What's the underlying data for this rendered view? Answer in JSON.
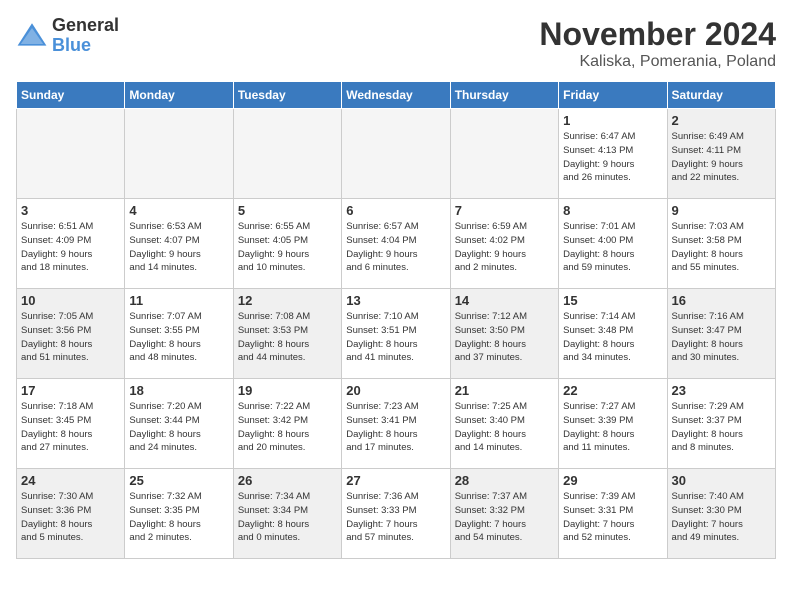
{
  "header": {
    "logo_line1": "General",
    "logo_line2": "Blue",
    "month": "November 2024",
    "location": "Kaliska, Pomerania, Poland"
  },
  "weekdays": [
    "Sunday",
    "Monday",
    "Tuesday",
    "Wednesday",
    "Thursday",
    "Friday",
    "Saturday"
  ],
  "weeks": [
    [
      {
        "day": "",
        "info": "",
        "empty": true
      },
      {
        "day": "",
        "info": "",
        "empty": true
      },
      {
        "day": "",
        "info": "",
        "empty": true
      },
      {
        "day": "",
        "info": "",
        "empty": true
      },
      {
        "day": "",
        "info": "",
        "empty": true
      },
      {
        "day": "1",
        "info": "Sunrise: 6:47 AM\nSunset: 4:13 PM\nDaylight: 9 hours\nand 26 minutes.",
        "empty": false
      },
      {
        "day": "2",
        "info": "Sunrise: 6:49 AM\nSunset: 4:11 PM\nDaylight: 9 hours\nand 22 minutes.",
        "empty": false
      }
    ],
    [
      {
        "day": "3",
        "info": "Sunrise: 6:51 AM\nSunset: 4:09 PM\nDaylight: 9 hours\nand 18 minutes.",
        "empty": false
      },
      {
        "day": "4",
        "info": "Sunrise: 6:53 AM\nSunset: 4:07 PM\nDaylight: 9 hours\nand 14 minutes.",
        "empty": false
      },
      {
        "day": "5",
        "info": "Sunrise: 6:55 AM\nSunset: 4:05 PM\nDaylight: 9 hours\nand 10 minutes.",
        "empty": false
      },
      {
        "day": "6",
        "info": "Sunrise: 6:57 AM\nSunset: 4:04 PM\nDaylight: 9 hours\nand 6 minutes.",
        "empty": false
      },
      {
        "day": "7",
        "info": "Sunrise: 6:59 AM\nSunset: 4:02 PM\nDaylight: 9 hours\nand 2 minutes.",
        "empty": false
      },
      {
        "day": "8",
        "info": "Sunrise: 7:01 AM\nSunset: 4:00 PM\nDaylight: 8 hours\nand 59 minutes.",
        "empty": false
      },
      {
        "day": "9",
        "info": "Sunrise: 7:03 AM\nSunset: 3:58 PM\nDaylight: 8 hours\nand 55 minutes.",
        "empty": false
      }
    ],
    [
      {
        "day": "10",
        "info": "Sunrise: 7:05 AM\nSunset: 3:56 PM\nDaylight: 8 hours\nand 51 minutes.",
        "empty": false
      },
      {
        "day": "11",
        "info": "Sunrise: 7:07 AM\nSunset: 3:55 PM\nDaylight: 8 hours\nand 48 minutes.",
        "empty": false
      },
      {
        "day": "12",
        "info": "Sunrise: 7:08 AM\nSunset: 3:53 PM\nDaylight: 8 hours\nand 44 minutes.",
        "empty": false
      },
      {
        "day": "13",
        "info": "Sunrise: 7:10 AM\nSunset: 3:51 PM\nDaylight: 8 hours\nand 41 minutes.",
        "empty": false
      },
      {
        "day": "14",
        "info": "Sunrise: 7:12 AM\nSunset: 3:50 PM\nDaylight: 8 hours\nand 37 minutes.",
        "empty": false
      },
      {
        "day": "15",
        "info": "Sunrise: 7:14 AM\nSunset: 3:48 PM\nDaylight: 8 hours\nand 34 minutes.",
        "empty": false
      },
      {
        "day": "16",
        "info": "Sunrise: 7:16 AM\nSunset: 3:47 PM\nDaylight: 8 hours\nand 30 minutes.",
        "empty": false
      }
    ],
    [
      {
        "day": "17",
        "info": "Sunrise: 7:18 AM\nSunset: 3:45 PM\nDaylight: 8 hours\nand 27 minutes.",
        "empty": false
      },
      {
        "day": "18",
        "info": "Sunrise: 7:20 AM\nSunset: 3:44 PM\nDaylight: 8 hours\nand 24 minutes.",
        "empty": false
      },
      {
        "day": "19",
        "info": "Sunrise: 7:22 AM\nSunset: 3:42 PM\nDaylight: 8 hours\nand 20 minutes.",
        "empty": false
      },
      {
        "day": "20",
        "info": "Sunrise: 7:23 AM\nSunset: 3:41 PM\nDaylight: 8 hours\nand 17 minutes.",
        "empty": false
      },
      {
        "day": "21",
        "info": "Sunrise: 7:25 AM\nSunset: 3:40 PM\nDaylight: 8 hours\nand 14 minutes.",
        "empty": false
      },
      {
        "day": "22",
        "info": "Sunrise: 7:27 AM\nSunset: 3:39 PM\nDaylight: 8 hours\nand 11 minutes.",
        "empty": false
      },
      {
        "day": "23",
        "info": "Sunrise: 7:29 AM\nSunset: 3:37 PM\nDaylight: 8 hours\nand 8 minutes.",
        "empty": false
      }
    ],
    [
      {
        "day": "24",
        "info": "Sunrise: 7:30 AM\nSunset: 3:36 PM\nDaylight: 8 hours\nand 5 minutes.",
        "empty": false
      },
      {
        "day": "25",
        "info": "Sunrise: 7:32 AM\nSunset: 3:35 PM\nDaylight: 8 hours\nand 2 minutes.",
        "empty": false
      },
      {
        "day": "26",
        "info": "Sunrise: 7:34 AM\nSunset: 3:34 PM\nDaylight: 8 hours\nand 0 minutes.",
        "empty": false
      },
      {
        "day": "27",
        "info": "Sunrise: 7:36 AM\nSunset: 3:33 PM\nDaylight: 7 hours\nand 57 minutes.",
        "empty": false
      },
      {
        "day": "28",
        "info": "Sunrise: 7:37 AM\nSunset: 3:32 PM\nDaylight: 7 hours\nand 54 minutes.",
        "empty": false
      },
      {
        "day": "29",
        "info": "Sunrise: 7:39 AM\nSunset: 3:31 PM\nDaylight: 7 hours\nand 52 minutes.",
        "empty": false
      },
      {
        "day": "30",
        "info": "Sunrise: 7:40 AM\nSunset: 3:30 PM\nDaylight: 7 hours\nand 49 minutes.",
        "empty": false
      }
    ]
  ]
}
